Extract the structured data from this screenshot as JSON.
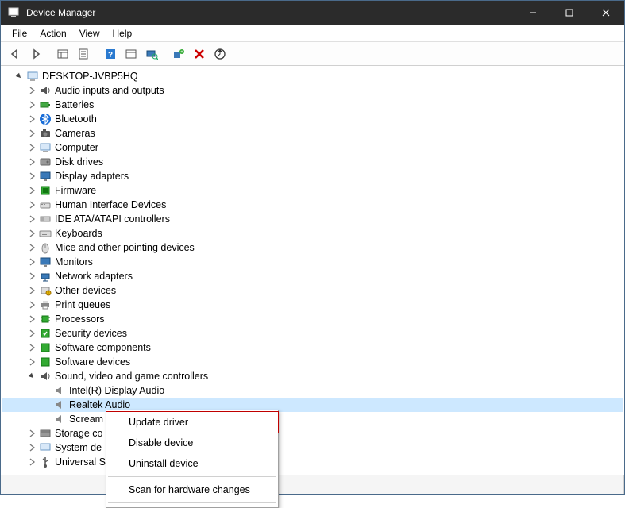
{
  "window": {
    "title": "Device Manager"
  },
  "menu": {
    "file": "File",
    "action": "Action",
    "view": "View",
    "help": "Help"
  },
  "root": {
    "name": "DESKTOP-JVBP5HQ"
  },
  "cats": {
    "audio": "Audio inputs and outputs",
    "batteries": "Batteries",
    "bluetooth": "Bluetooth",
    "cameras": "Cameras",
    "computer": "Computer",
    "disks": "Disk drives",
    "display": "Display adapters",
    "firmware": "Firmware",
    "hid": "Human Interface Devices",
    "ide": "IDE ATA/ATAPI controllers",
    "keyboards": "Keyboards",
    "mice": "Mice and other pointing devices",
    "monitors": "Monitors",
    "network": "Network adapters",
    "other": "Other devices",
    "print": "Print queues",
    "processors": "Processors",
    "security": "Security devices",
    "swcomp": "Software components",
    "swdev": "Software devices",
    "sound": "Sound, video and game controllers",
    "storage": "Storage co",
    "system": "System de",
    "usb": "Universal S"
  },
  "snd": {
    "intel": "Intel(R) Display Audio",
    "realtek": "Realtek Audio",
    "scream": "Scream"
  },
  "ctx": {
    "update": "Update driver",
    "disable": "Disable device",
    "uninstall": "Uninstall device",
    "scan": "Scan for hardware changes"
  }
}
